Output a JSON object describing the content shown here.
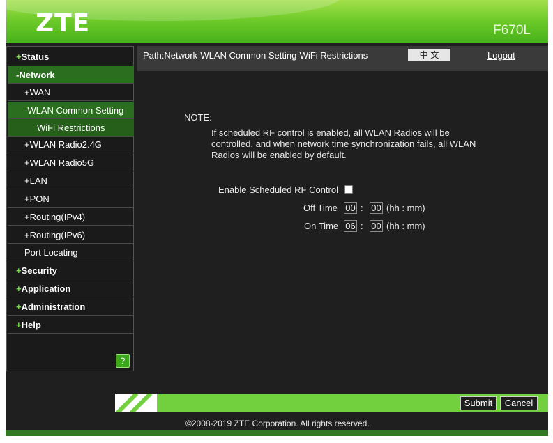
{
  "header": {
    "brand": "ZTE",
    "model": "F670L"
  },
  "pathbar": {
    "path": "Path:Network-WLAN Common Setting-WiFi Restrictions",
    "language": "中 文",
    "logout": "Logout"
  },
  "sidebar": {
    "items": [
      {
        "prefix": "+",
        "label": "Status"
      },
      {
        "prefix": "-",
        "label": "Network"
      },
      {
        "prefix": "+",
        "label": "WAN"
      },
      {
        "prefix": "-",
        "label": "WLAN Common Setting"
      },
      {
        "prefix": "",
        "label": "WiFi Restrictions"
      },
      {
        "prefix": "+",
        "label": "WLAN Radio2.4G"
      },
      {
        "prefix": "+",
        "label": "WLAN Radio5G"
      },
      {
        "prefix": "+",
        "label": "LAN"
      },
      {
        "prefix": "+",
        "label": "PON"
      },
      {
        "prefix": "+",
        "label": "Routing(IPv4)"
      },
      {
        "prefix": "+",
        "label": "Routing(IPv6)"
      },
      {
        "prefix": "",
        "label": "Port Locating"
      },
      {
        "prefix": "+",
        "label": "Security"
      },
      {
        "prefix": "+",
        "label": "Application"
      },
      {
        "prefix": "+",
        "label": "Administration"
      },
      {
        "prefix": "+",
        "label": "Help"
      }
    ],
    "help_icon": "question-icon"
  },
  "content": {
    "note_title": "NOTE:",
    "note_text": "If scheduled RF control is enabled, all WLAN Radios will be controlled, and when network time synchronization fails, all WLAN Radios will be enabled by default.",
    "enable_label": "Enable Scheduled RF Control",
    "enable_checked": false,
    "off_time_label": "Off Time",
    "off_hour": "00",
    "off_min": "00",
    "on_time_label": "On Time",
    "on_hour": "06",
    "on_min": "00",
    "colon": ":",
    "time_format": "(hh : mm)"
  },
  "footer": {
    "submit": "Submit",
    "cancel": "Cancel",
    "copyright": "©2008-2019 ZTE Corporation. All rights reserved."
  },
  "colors": {
    "brand_green": "#46b21a",
    "background": "#1f1f1f",
    "active_nav": "#2c6e1f"
  }
}
